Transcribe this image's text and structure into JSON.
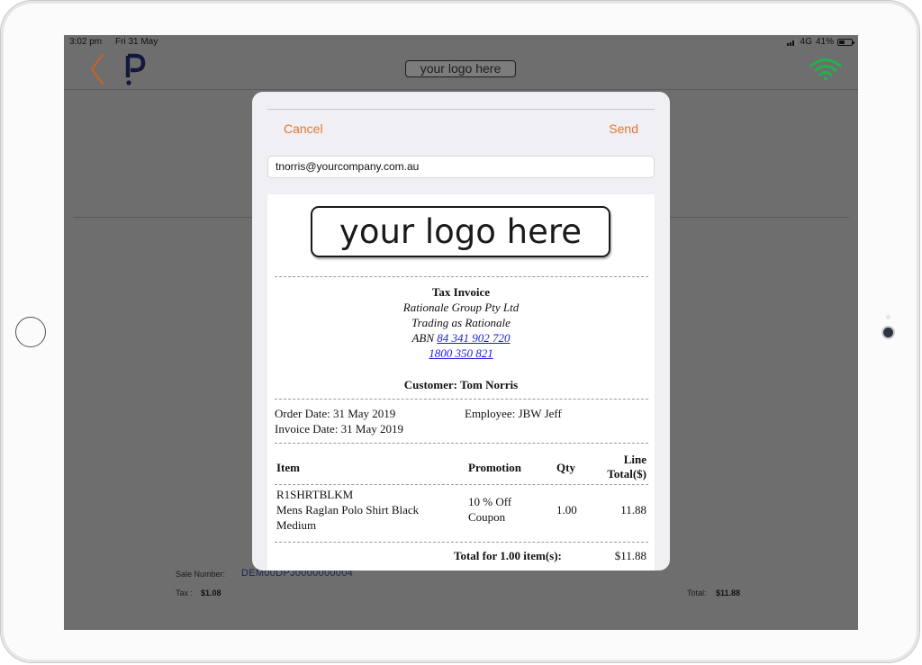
{
  "status_bar": {
    "time": "3:02 pm",
    "date": "Fri 31 May",
    "network": "4G",
    "battery": "41%"
  },
  "header": {
    "logo_text": "your logo here"
  },
  "background": {
    "sale_number_label": "Sale Number:",
    "sale_number": "DEM00DPJ0000000004",
    "tax_label": "Tax :",
    "tax_value": "$1.08",
    "total_label": "Total:",
    "total_value": "$11.88"
  },
  "modal": {
    "cancel_label": "Cancel",
    "send_label": "Send",
    "email_value": "tnorris@yourcompany.com.au"
  },
  "invoice": {
    "logo_text": "your logo here",
    "title": "Tax Invoice",
    "company": "Rationale Group Pty Ltd",
    "trading_as": "Trading as Rationale",
    "abn_label": "ABN",
    "abn": "84 341 902 720",
    "phone": "1800 350 821",
    "customer": "Customer: Tom Norris",
    "order_date": "Order Date: 31 May 2019",
    "invoice_date": "Invoice Date: 31 May 2019",
    "employee": "Employee: JBW Jeff",
    "columns": {
      "item": "Item",
      "promotion": "Promotion",
      "qty": "Qty",
      "line_total_1": "Line",
      "line_total_2": "Total($)"
    },
    "items": [
      {
        "code": "R1SHRTBLKM",
        "desc_1": "Mens Raglan Polo Shirt Black",
        "desc_2": "Medium",
        "promo_1": "10 % Off",
        "promo_2": "Coupon",
        "qty": "1.00",
        "total": "11.88"
      }
    ],
    "total_label": "Total for 1.00 item(s):",
    "total_value": "$11.88"
  },
  "colors": {
    "accent": "#e2782c",
    "wifi": "#22b14c",
    "link": "#1a1ae6",
    "overlay_bg": "#6e6e6e"
  },
  "icons": [
    "back-chevron-icon",
    "app-logo-icon",
    "wifi-icon",
    "signal-icon",
    "battery-icon"
  ]
}
